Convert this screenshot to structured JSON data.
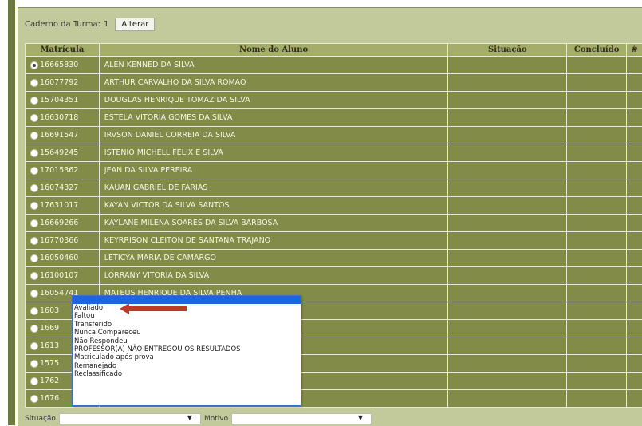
{
  "toolbar": {
    "caderno_label": "Caderno da Turma:",
    "caderno_value": "1",
    "alterar_label": "Alterar"
  },
  "table": {
    "headers": [
      "Matrícula",
      "Nome do Aluno",
      "Situação",
      "Concluído",
      "#"
    ],
    "rows": [
      {
        "matricula": "16665830",
        "nome": "ALEN KENNED DA SILVA"
      },
      {
        "matricula": "16077792",
        "nome": "ARTHUR CARVALHO DA SILVA ROMAO"
      },
      {
        "matricula": "15704351",
        "nome": "DOUGLAS HENRIQUE TOMAZ DA SILVA"
      },
      {
        "matricula": "16630718",
        "nome": "ESTELA VITORIA GOMES DA SILVA"
      },
      {
        "matricula": "16691547",
        "nome": "IRVSON DANIEL CORREIA DA SILVA"
      },
      {
        "matricula": "15649245",
        "nome": "ISTENIO MICHELL FELIX E SILVA"
      },
      {
        "matricula": "17015362",
        "nome": "JEAN DA SILVA PEREIRA"
      },
      {
        "matricula": "16074327",
        "nome": "KAUAN GABRIEL DE FARIAS"
      },
      {
        "matricula": "17631017",
        "nome": "KAYAN VICTOR DA SILVA SANTOS"
      },
      {
        "matricula": "16669266",
        "nome": "KAYLANE MILENA SOARES DA SILVA BARBOSA"
      },
      {
        "matricula": "16770366",
        "nome": "KEYRRISON CLEITON DE SANTANA TRAJANO"
      },
      {
        "matricula": "16050460",
        "nome": "LETICYA MARIA DE CAMARGO"
      },
      {
        "matricula": "16100107",
        "nome": "LORRANY VITORIA DA SILVA"
      },
      {
        "matricula": "16054741",
        "nome": "MATEUS HENRIQUE DA SILVA PENHA"
      },
      {
        "matricula": "1603",
        "nome": ""
      },
      {
        "matricula": "1669",
        "nome": ""
      },
      {
        "matricula": "1613",
        "nome": ""
      },
      {
        "matricula": "1575",
        "nome": ""
      },
      {
        "matricula": "1762",
        "nome": ""
      },
      {
        "matricula": "1676",
        "nome": ""
      }
    ]
  },
  "dropdown": {
    "options": [
      "Avaliado",
      "Faltou",
      "Transferido",
      "Nunca Compareceu",
      "Não Respondeu",
      "PROFESSOR(A) NÃO ENTREGOU OS RESULTADOS",
      "Matriculado após prova",
      "Remanejado",
      "Reclassificado"
    ]
  },
  "bottom": {
    "situacao_label": "Situação",
    "motivo_label": "Motivo",
    "dropdown_arrow": "▼"
  },
  "colors": {
    "panel_bg": "#c2c99a",
    "row_bg": "#838b48",
    "header_bg": "#a4ad69",
    "highlight": "#1e63e0",
    "annotation_arrow": "#c0392b"
  }
}
